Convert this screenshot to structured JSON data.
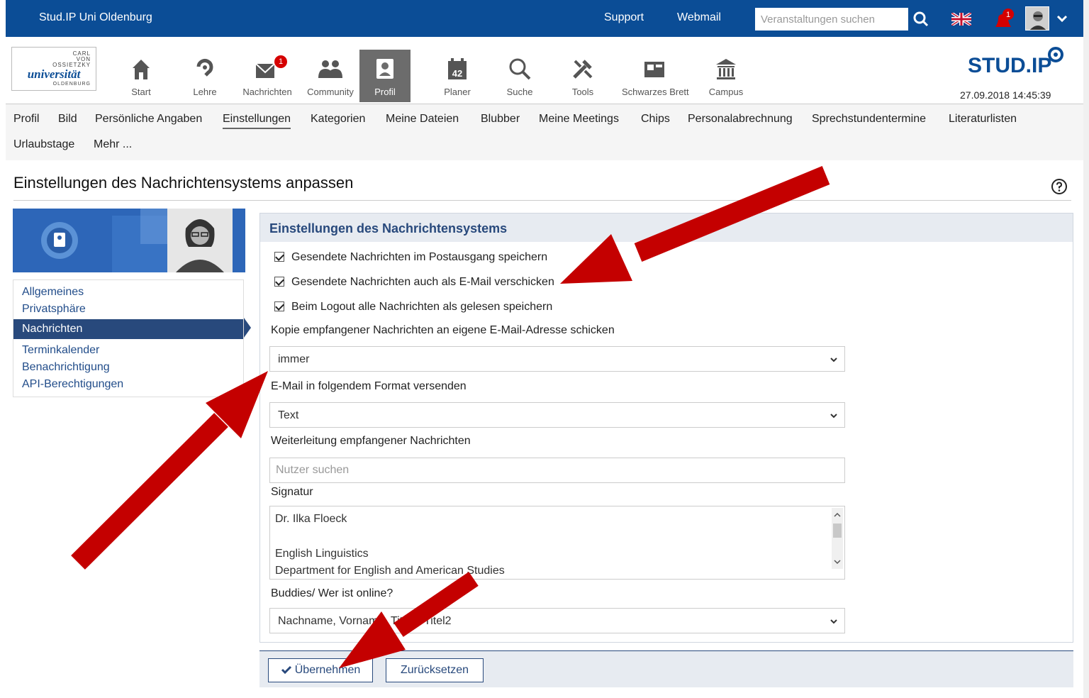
{
  "topbar": {
    "site_title": "Stud.IP Uni Oldenburg",
    "support": "Support",
    "webmail": "Webmail",
    "search_placeholder": "Veranstaltungen suchen",
    "notification_count": "1"
  },
  "uni_logo": {
    "line1": "CARL",
    "line2": "VON",
    "line3": "OSSIETZKY",
    "line4": "universität",
    "line5": "OLDENBURG"
  },
  "mainnav": {
    "items": [
      {
        "label": "Start",
        "icon": "home-icon"
      },
      {
        "label": "Lehre",
        "icon": "lehre-icon"
      },
      {
        "label": "Nachrichten",
        "icon": "mail-icon",
        "badge": "1"
      },
      {
        "label": "Community",
        "icon": "community-icon"
      },
      {
        "label": "Profil",
        "icon": "profile-icon"
      },
      {
        "label": "Planer",
        "icon": "calendar-icon",
        "day": "42"
      },
      {
        "label": "Suche",
        "icon": "search-icon"
      },
      {
        "label": "Tools",
        "icon": "tools-icon"
      },
      {
        "label": "Schwarzes Brett",
        "icon": "board-icon"
      },
      {
        "label": "Campus",
        "icon": "campus-icon"
      }
    ],
    "logo_text": "STUD.IP",
    "datetime": "27.09.2018 14:45:39"
  },
  "subnav": {
    "items": [
      "Profil",
      "Bild",
      "Persönliche Angaben",
      "Einstellungen",
      "Kategorien",
      "Meine Dateien",
      "Blubber",
      "Meine Meetings",
      "Chips",
      "Personalabrechnung",
      "Sprechstundentermine",
      "Literaturlisten",
      "Urlaubstage",
      "Mehr ..."
    ]
  },
  "page": {
    "title": "Einstellungen des Nachrichtensystems anpassen"
  },
  "sidebar": {
    "items": [
      "Allgemeines",
      "Privatsphäre",
      "Nachrichten",
      "Terminkalender",
      "Benachrichtigung",
      "API-Berechtigungen"
    ]
  },
  "form": {
    "heading": "Einstellungen des Nachrichtensystems",
    "checkbox1": "Gesendete Nachrichten im Postausgang speichern",
    "checkbox2": "Gesendete Nachrichten auch als E-Mail verschicken",
    "checkbox3": "Beim Logout alle Nachrichten als gelesen speichern",
    "copy_label": "Kopie empfangener Nachrichten an eigene E-Mail-Adresse schicken",
    "copy_value": "immer",
    "format_label": "E-Mail in folgendem Format versenden",
    "format_value": "Text",
    "forward_label": "Weiterleitung empfangener Nachrichten",
    "forward_placeholder": "Nutzer suchen",
    "signature_label": "Signatur",
    "signature_line1": "Dr. Ilka Floeck",
    "signature_line2": "English Linguistics",
    "signature_line3": "Department for English and American Studies",
    "buddies_label": "Buddies/ Wer ist online?",
    "buddies_value": "Nachname, Vorname, Titel1, Titel2"
  },
  "buttons": {
    "apply": "Übernehmen",
    "reset": "Zurücksetzen"
  },
  "colors": {
    "topbar": "#0b4d96",
    "accent": "#28497c",
    "arrow": "#c40000",
    "badge": "#d50000"
  }
}
